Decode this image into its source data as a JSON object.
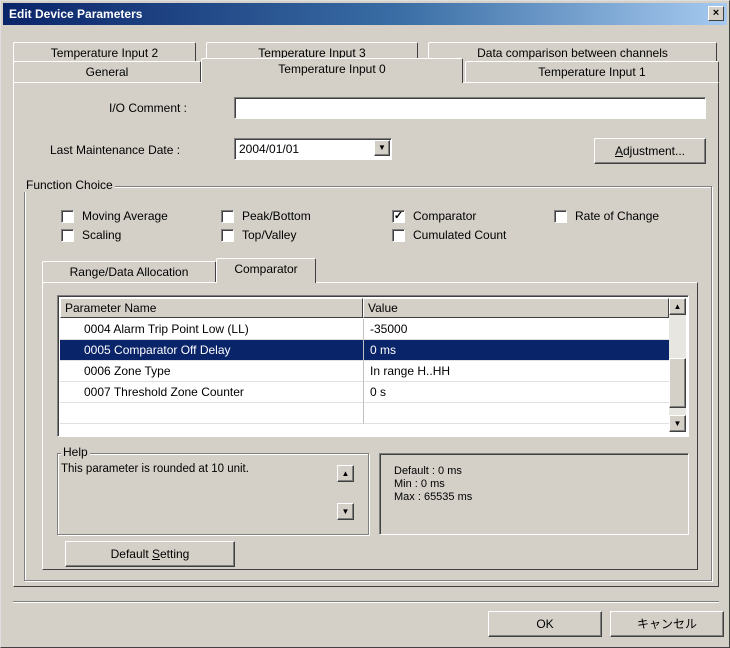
{
  "window": {
    "title": "Edit Device Parameters",
    "close_label": "×"
  },
  "tabs": {
    "row_top": [
      "Temperature Input 2",
      "Temperature Input 3",
      "Data comparison between channels"
    ],
    "row_bottom": [
      "General",
      "Temperature Input 0",
      "Temperature Input 1"
    ],
    "active": "Temperature Input 0"
  },
  "io_comment": {
    "label": "I/O Comment :",
    "value": ""
  },
  "maintenance": {
    "label": "Last Maintenance Date :",
    "value": "2004/01/01"
  },
  "adjustment_button": {
    "prefix": "A",
    "rest": "djustment..."
  },
  "function_choice": {
    "title": "Function Choice",
    "options": [
      {
        "label": "Moving Average",
        "checked": false
      },
      {
        "label": "Peak/Bottom",
        "checked": false
      },
      {
        "label": "Comparator",
        "checked": true
      },
      {
        "label": "Rate of Change",
        "checked": false
      },
      {
        "label": "Scaling",
        "checked": false
      },
      {
        "label": "Top/Valley",
        "checked": false
      },
      {
        "label": "Cumulated Count",
        "checked": false
      }
    ]
  },
  "inner_tabs": [
    "Range/Data Allocation",
    "Comparator"
  ],
  "grid": {
    "headers": [
      "Parameter Name",
      "Value"
    ],
    "rows": [
      {
        "name": "0004 Alarm Trip Point Low (LL)",
        "value": "-35000"
      },
      {
        "name": "0005 Comparator Off Delay",
        "value": "0 ms",
        "selected": true
      },
      {
        "name": "0006 Zone Type",
        "value": "In range H..HH"
      },
      {
        "name": "0007 Threshold Zone Counter",
        "value": "0 s"
      }
    ]
  },
  "help": {
    "title": "Help",
    "text": "This parameter is rounded at 10 unit.",
    "default_line": "Default : 0 ms",
    "min_line": "Min : 0 ms",
    "max_line": "Max : 65535 ms"
  },
  "default_setting_button": {
    "before": "Default ",
    "accel": "S",
    "after": "etting"
  },
  "footer": {
    "ok_label": "OK",
    "cancel_label": "キャンセル"
  },
  "colors": {
    "selection": "#0a246a",
    "face": "#d4d0c8",
    "title_start": "#0a246a"
  }
}
